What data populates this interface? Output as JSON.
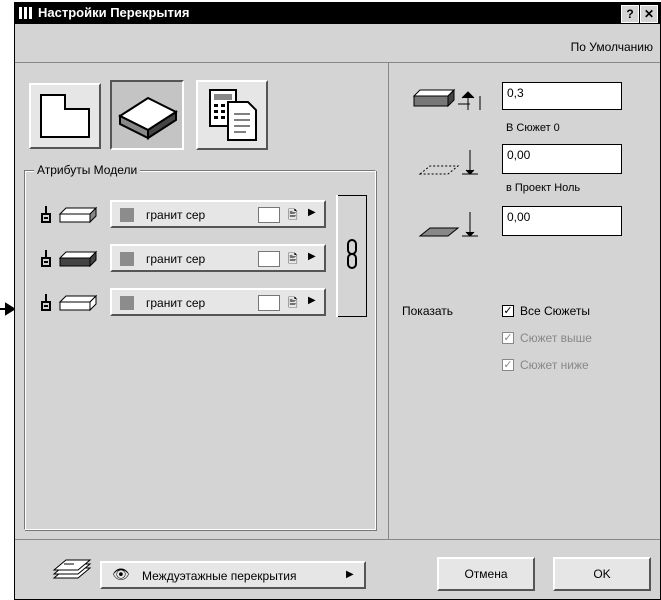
{
  "window": {
    "title": "Настройки Перекрытия",
    "help_btn": "?",
    "close_btn": "✕",
    "preset_label": "По Умолчанию"
  },
  "model_attributes": {
    "legend": "Атрибуты Модели",
    "rows": [
      {
        "material": "гранит сер",
        "icon": "top-surface-icon"
      },
      {
        "material": "гранит сер",
        "icon": "side-surface-icon"
      },
      {
        "material": "гранит сер",
        "icon": "bottom-surface-icon"
      }
    ]
  },
  "geometry": {
    "thickness": "0,3",
    "to_story_label": "В Сюжет 0",
    "to_story_value": "0,00",
    "to_project_label": "в Проект Ноль",
    "to_project_value": "0,00"
  },
  "show": {
    "label": "Показать",
    "options": [
      {
        "label": "Все Сюжеты",
        "checked": true,
        "enabled": true
      },
      {
        "label": "Сюжет выше",
        "checked": true,
        "enabled": false
      },
      {
        "label": "Сюжет ниже",
        "checked": true,
        "enabled": false
      }
    ]
  },
  "footer": {
    "layer": "Междуэтажные перекрытия",
    "cancel": "Отмена",
    "ok": "OK"
  }
}
